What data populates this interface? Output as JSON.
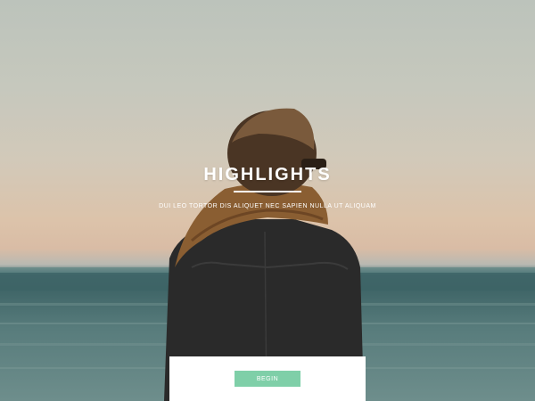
{
  "hero": {
    "title": "HIGHLIGHTS",
    "subtitle": "DUI LEO TORTOR DIS ALIQUET NEC SAPIEN NULLA UT ALIQUAM"
  },
  "cta": {
    "begin_label": "BEGIN"
  },
  "colors": {
    "accent": "#7fcfa8",
    "panel": "#ffffff",
    "sea": "#3f6567",
    "sky": "#c6c8bd"
  }
}
